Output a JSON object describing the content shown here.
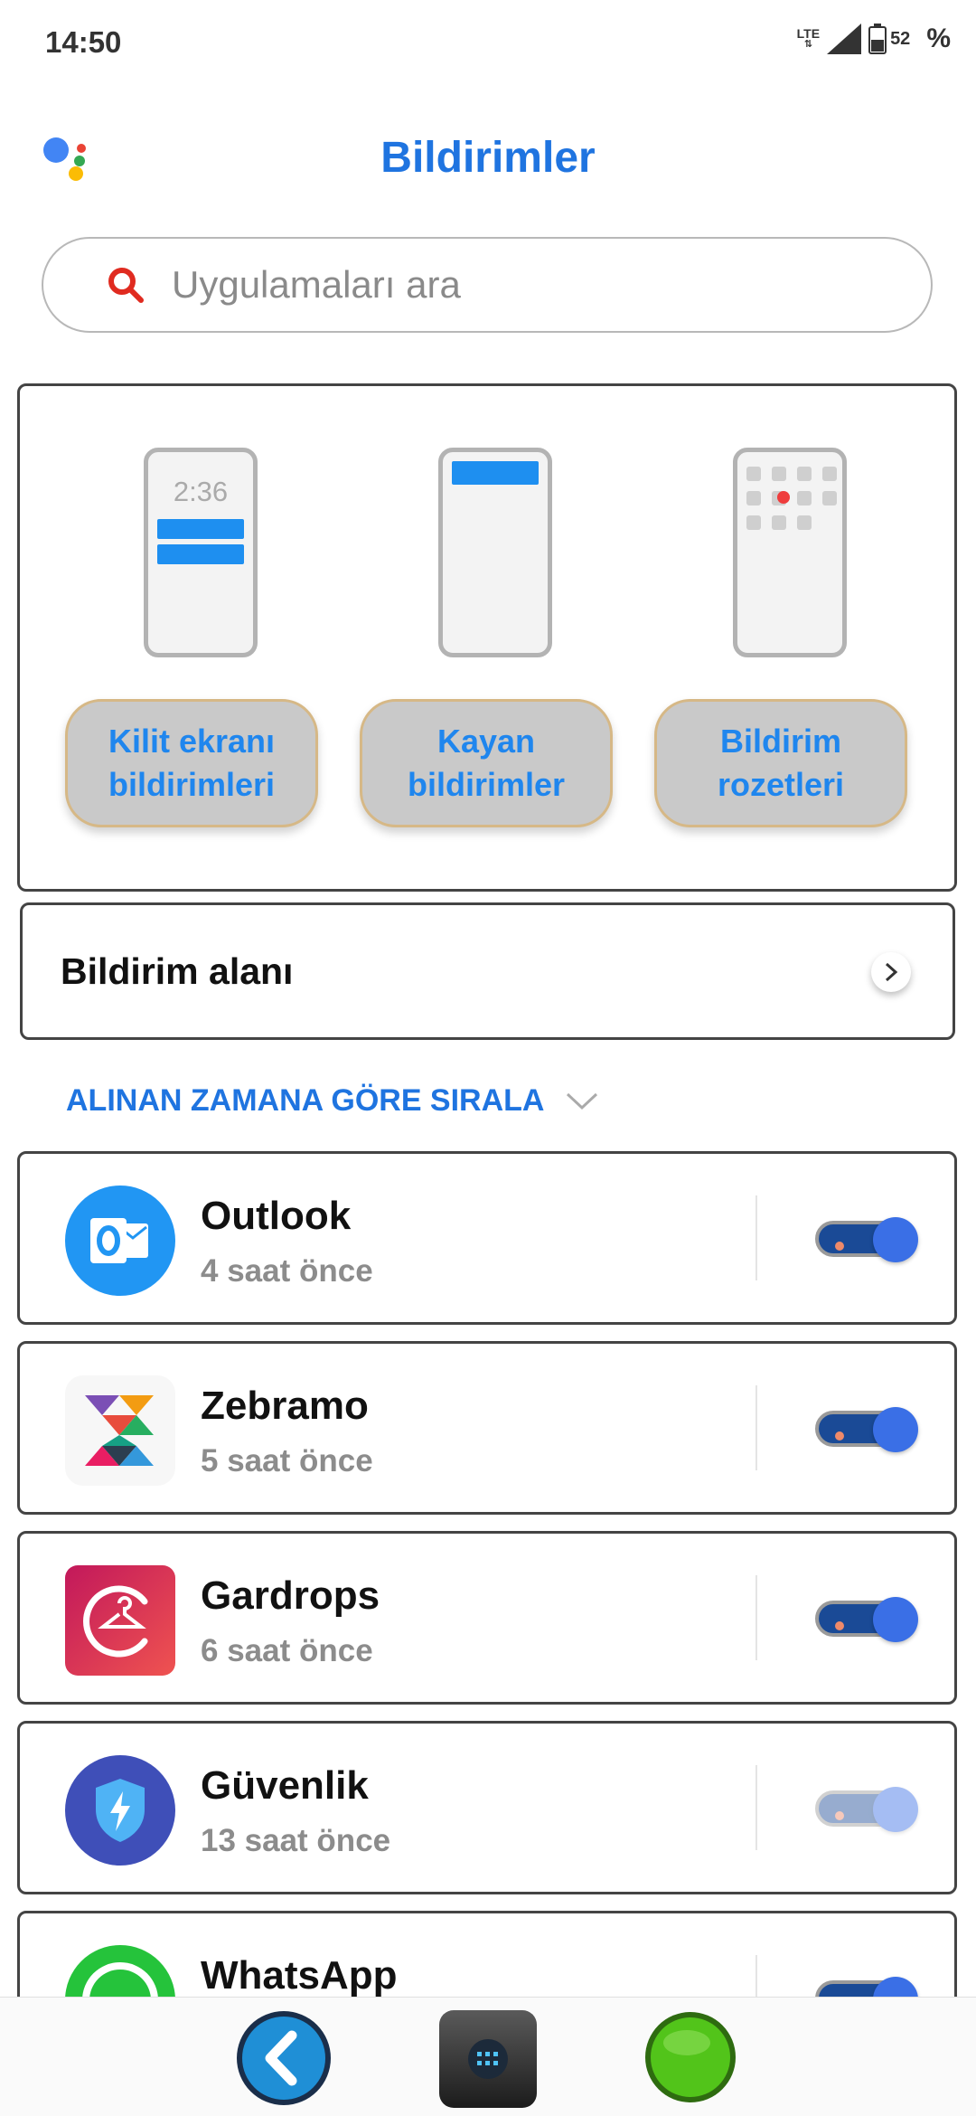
{
  "status_bar": {
    "time": "14:50",
    "network": "LTE",
    "battery": "52",
    "battery_unit": "%"
  },
  "header": {
    "title": "Bildirimler"
  },
  "search": {
    "placeholder": "Uygulamaları ara"
  },
  "notification_types": {
    "lock_screen": {
      "label": "Kilit ekranı\nbildirimleri",
      "preview_time": "2:36"
    },
    "floating": {
      "label": "Kayan\nbildirimler"
    },
    "badges": {
      "label": "Bildirim\nrozetleri"
    }
  },
  "notification_area": {
    "label": "Bildirim alanı"
  },
  "sort": {
    "label": "ALINAN ZAMANA GÖRE SIRALA"
  },
  "apps": [
    {
      "name": "Outlook",
      "time": "4 saat önce",
      "enabled": true
    },
    {
      "name": "Zebramo",
      "time": "5 saat önce",
      "enabled": true
    },
    {
      "name": "Gardrops",
      "time": "6 saat önce",
      "enabled": true
    },
    {
      "name": "Güvenlik",
      "time": "13 saat önce",
      "enabled": true,
      "locked": true
    },
    {
      "name": "WhatsApp",
      "time": "",
      "enabled": true
    }
  ],
  "colors": {
    "accent": "#1f74e0",
    "toggle_track": "#1a4a96",
    "toggle_knob": "#3a6fe6"
  }
}
